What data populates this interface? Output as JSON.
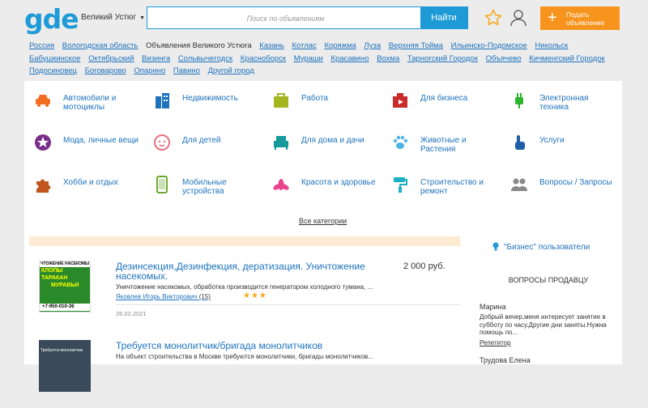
{
  "header": {
    "logo": "gde",
    "city": "Великий Устюг",
    "search_placeholder": "Поиск по объявлениям",
    "search_button": "Найти",
    "post_ad_line1": "Подать",
    "post_ad_line2": "объявление"
  },
  "city_links": [
    {
      "label": "Россия",
      "link": true
    },
    {
      "label": "Вологодская область",
      "link": true
    },
    {
      "label": "Объявления Великого Устюга",
      "link": false
    },
    {
      "label": "Казань",
      "link": true
    },
    {
      "label": "Котлас",
      "link": true
    },
    {
      "label": "Коряжма",
      "link": true
    },
    {
      "label": "Луза",
      "link": true
    },
    {
      "label": "Верхняя Тойма",
      "link": true
    },
    {
      "label": "Ильинско-Подомское",
      "link": true
    },
    {
      "label": "Никольск",
      "link": true
    },
    {
      "label": "Бабушкинское",
      "link": true
    },
    {
      "label": "Октябрьский",
      "link": true
    },
    {
      "label": "Визинга",
      "link": true
    },
    {
      "label": "Сольвычегодск",
      "link": true
    },
    {
      "label": "Красноборск",
      "link": true
    },
    {
      "label": "Мураши",
      "link": true
    },
    {
      "label": "Красавино",
      "link": true
    },
    {
      "label": "Вохма",
      "link": true
    },
    {
      "label": "Тарногский Городок",
      "link": true
    },
    {
      "label": "Объячево",
      "link": true
    },
    {
      "label": "Кичменгский Городок",
      "link": true
    },
    {
      "label": "Подосиновец",
      "link": true
    },
    {
      "label": "Боговарово",
      "link": true
    },
    {
      "label": "Опарино",
      "link": true
    },
    {
      "label": "Павино",
      "link": true
    },
    {
      "label": "Другой город",
      "link": true
    }
  ],
  "categories": [
    {
      "label": "Автомобили и мотоциклы",
      "icon": "car-icon",
      "color": "#f26d21"
    },
    {
      "label": "Недвижимость",
      "icon": "building-icon",
      "color": "#1e73be"
    },
    {
      "label": "Работа",
      "icon": "briefcase-icon",
      "color": "#a4b61d"
    },
    {
      "label": "Для бизнеса",
      "icon": "business-icon",
      "color": "#c92a2a"
    },
    {
      "label": "Электронная техника",
      "icon": "plug-icon",
      "color": "#2ab42a"
    },
    {
      "label": "Мода, личные вещи",
      "icon": "fashion-icon",
      "color": "#7b2d8b"
    },
    {
      "label": "Для детей",
      "icon": "baby-icon",
      "color": "#e8727a"
    },
    {
      "label": "Для дома и дачи",
      "icon": "armchair-icon",
      "color": "#159a9c"
    },
    {
      "label": "Животные и Растения",
      "icon": "paw-icon",
      "color": "#4fb3e6"
    },
    {
      "label": "Услуги",
      "icon": "hand-pointer-icon",
      "color": "#1e5fa8"
    },
    {
      "label": "Хобби и отдых",
      "icon": "puzzle-icon",
      "color": "#c0561e"
    },
    {
      "label": "Мобильные устройства",
      "icon": "mobile-icon",
      "color": "#6ea82f"
    },
    {
      "label": "Красота и здоровье",
      "icon": "lotus-icon",
      "color": "#e8438c"
    },
    {
      "label": "Строительство и ремонт",
      "icon": "paint-roller-icon",
      "color": "#1bb0c4"
    },
    {
      "label": "Вопросы / Запросы",
      "icon": "people-icon",
      "color": "#8a8a8a"
    }
  ],
  "all_categories": "Все категории",
  "items": [
    {
      "title": "Дезинсекция,Дезинфекция, дератизация. Уничтожение насекомых.",
      "price": "2 000 руб.",
      "desc": "Уничтожение насекомых, обработка производится генератором холодного тумана, ...",
      "seller": "Яковлев Игорь Викторович",
      "rating_count": "(15)",
      "stars": "★★★",
      "date": "26.02.2021",
      "thumb_lines": [
        "ЧТОЖЕНИЕ НАСЕКОМЫ",
        "КЛОПЫ ТАРАКАН",
        "МУРАВЬИ",
        "+7-950-010-36"
      ]
    },
    {
      "title": "Требуется монолитчик/бригада монолитчиков",
      "price": "",
      "desc": "На объект строительства в Москве требуются монолитчики, бригады монолитчиков...",
      "seller": "",
      "rating_count": "",
      "stars": "",
      "date": "",
      "thumb_lines": [
        "Требуется монолитчик"
      ]
    }
  ],
  "sidebar": {
    "biz_users": "\"Бизнес\" пользователи",
    "questions_header": "ВОПРОСЫ ПРОДАВЦУ",
    "questions": [
      {
        "name": "Марина",
        "text": "Добрый вечер,меня интересует занятие в субботу по часу.Другие дни заняты.Нужна помощь по...",
        "link": "Репетитор"
      },
      {
        "name": "Трудова Елена",
        "text": "",
        "link": ""
      }
    ]
  },
  "colors": {
    "brand": "#1e9ad6",
    "accent": "#f7941d",
    "link": "#1e73be",
    "banner": "#fdebd3"
  }
}
